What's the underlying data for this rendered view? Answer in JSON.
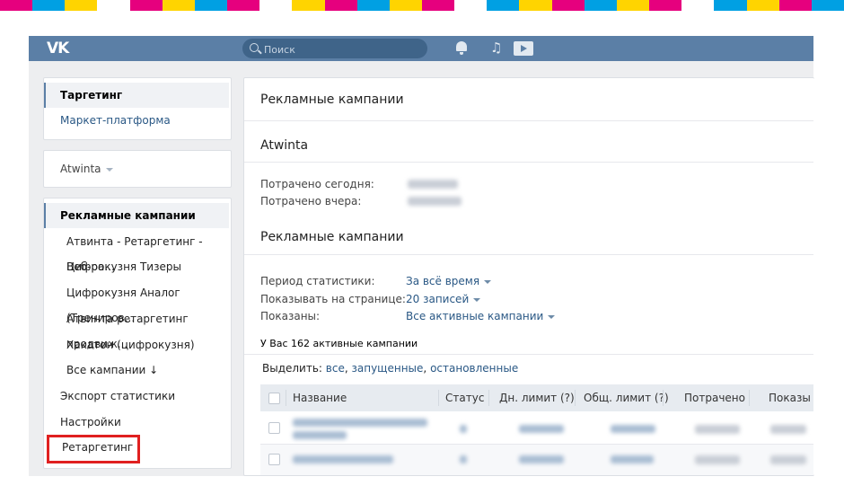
{
  "stripe_colors": [
    "#e6007e",
    "#00a0e3",
    "#ffd400",
    "#ffffff"
  ],
  "header": {
    "logo": "VK",
    "search_placeholder": "Поиск",
    "bg_color": "#5b7fa6"
  },
  "sidebar": {
    "top_items": [
      "Таргетинг",
      "Маркет-платформа"
    ],
    "account": "Atwinta",
    "section_title": "Рекламные кампании",
    "campaigns": [
      "Атвинта - Ретаргетинг - Веб-ра...",
      "Цифрокузня Тизеры",
      "Цифрокузня Аналог (Трениров...",
      "Атвинта ретаргетинг продвиж...",
      "Хакатон (цифрокузня)",
      "Все кампании ↓"
    ],
    "bottom_items": [
      "Экспорт статистики",
      "Настройки",
      "Ретаргетинг"
    ]
  },
  "main": {
    "page_title": "Рекламные кампании",
    "account_name": "Atwinta",
    "spent_today_label": "Потрачено сегодня:",
    "spent_yesterday_label": "Потрачено вчера:",
    "campaigns_title": "Рекламные кампании",
    "filters": [
      {
        "label": "Период статистики:",
        "value": "За всё время"
      },
      {
        "label": "Показывать на странице:",
        "value": "20 записей"
      },
      {
        "label": "Показаны:",
        "value": "Все активные кампании"
      }
    ],
    "active_count_text": "У Вас 162 активные кампании",
    "select_label": "Выделить:",
    "select_links": [
      "все",
      "запущенные",
      "остановленные"
    ],
    "table_headers": [
      "Название",
      "Статус",
      "Дн. лимит (?)",
      "Общ. лимит (?)",
      "Потрачено",
      "Показы"
    ]
  }
}
